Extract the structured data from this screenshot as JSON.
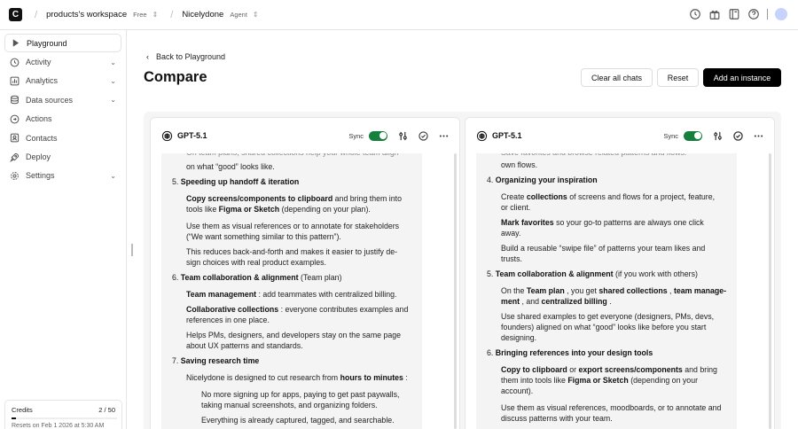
{
  "topbar": {
    "logo": "C",
    "workspace_name": "products's workspace",
    "workspace_plan": "Free",
    "project_name": "Nicelydone",
    "project_type": "Agent",
    "icons": [
      "history-icon",
      "gift-icon",
      "book-icon",
      "help-icon",
      "avatar"
    ]
  },
  "sidebar": {
    "items": [
      {
        "label": "Playground",
        "icon": "play-icon",
        "active": true,
        "chevron": false
      },
      {
        "label": "Activity",
        "icon": "clock-icon",
        "chevron": true
      },
      {
        "label": "Analytics",
        "icon": "chart-icon",
        "chevron": true
      },
      {
        "label": "Data sources",
        "icon": "database-icon",
        "chevron": true
      },
      {
        "label": "Actions",
        "icon": "actions-icon",
        "chevron": false
      },
      {
        "label": "Contacts",
        "icon": "contacts-icon",
        "chevron": false
      },
      {
        "label": "Deploy",
        "icon": "rocket-icon",
        "chevron": false
      },
      {
        "label": "Settings",
        "icon": "gear-icon",
        "chevron": true
      }
    ],
    "credits": {
      "label": "Credits",
      "value": "2 / 50",
      "used_fraction": 0.04,
      "reset_text": "Resets on Feb 1 2026 at 5:30 AM"
    }
  },
  "main": {
    "back_label": "Back to Playground",
    "title": "Compare",
    "buttons": {
      "clear": "Clear all chats",
      "reset": "Reset",
      "add": "Add an instance"
    }
  },
  "panels": [
    {
      "model": "GPT-5.1",
      "sync_label": "Sync",
      "lines": [
        {
          "t": "On team plans, shared collections help your whole team align",
          "cut": true
        },
        {
          "t": "on what “good” looks like."
        },
        {
          "t": "5.  <b>Speeding up handoff &amp; iteration</b>"
        },
        {
          "t": "<b>Copy screens/components to clipboard</b> and bring them into"
        },
        {
          "t": "tools like <b>Figma or Sketch</b> (depending on your plan)."
        },
        {
          "t": "Use them as visual references or to annotate for stakeholders"
        },
        {
          "t": "(“We want something similar to this pattern”)."
        },
        {
          "t": "This reduces back-and-forth and makes it easier to justify de-"
        },
        {
          "t": "sign choices with real product examples."
        },
        {
          "t": "6.  <b>Team collaboration &amp; alignment</b> (Team plan)"
        },
        {
          "t": "<b>Team management</b> : add teammates with centralized billing."
        },
        {
          "t": "<b>Collaborative collections</b> : everyone contributes examples and"
        },
        {
          "t": "references in one place."
        },
        {
          "t": "Helps PMs, designers, and developers stay on the same page"
        },
        {
          "t": "about UX patterns and standards."
        },
        {
          "t": "7.  <b>Saving research time</b>"
        },
        {
          "t": "Nicelydone is designed to cut research from <b>hours to minutes</b> :"
        },
        {
          "t": "No more signing up for apps, paying to get past paywalls,"
        },
        {
          "t": "taking manual screenshots, and organizing folders."
        },
        {
          "t": "Everything is already captured, tagged, and searchable."
        }
      ]
    },
    {
      "model": "GPT-5.1",
      "sync_label": "Sync",
      "lines": [
        {
          "t": "Save favorites and browse related patterns and flows.",
          "cut": true
        },
        {
          "t": "own flows."
        },
        {
          "t": "4.  <b>Organizing your inspiration</b>"
        },
        {
          "t": "Create <b>collections</b> of screens and flows for a project, feature,"
        },
        {
          "t": "or client."
        },
        {
          "t": "<b>Mark favorites</b> so your go-to patterns are always one click"
        },
        {
          "t": "away."
        },
        {
          "t": "Build a reusable “swipe file” of patterns your team likes and"
        },
        {
          "t": "trusts."
        },
        {
          "t": "5.  <b>Team collaboration &amp; alignment</b> (if you work with others)"
        },
        {
          "t": "On the <b>Team plan</b> , you get <b>shared collections</b> , <b>team manage-</b>"
        },
        {
          "t": "<b>ment</b> , and <b>centralized billing</b> ."
        },
        {
          "t": "Use shared examples to get everyone (designers, PMs, devs,"
        },
        {
          "t": "founders) aligned on what “good” looks like before you start"
        },
        {
          "t": "designing."
        },
        {
          "t": "6.  <b>Bringing references into your design tools</b>"
        },
        {
          "t": "<b>Copy to clipboard</b> or <b>export screens/components</b> and bring"
        },
        {
          "t": "them into tools like <b>Figma or Sketch</b> (depending on your"
        },
        {
          "t": "account)."
        },
        {
          "t": "Use them as visual references, moodboards, or to annotate and"
        },
        {
          "t": "discuss patterns with your team."
        }
      ]
    }
  ]
}
